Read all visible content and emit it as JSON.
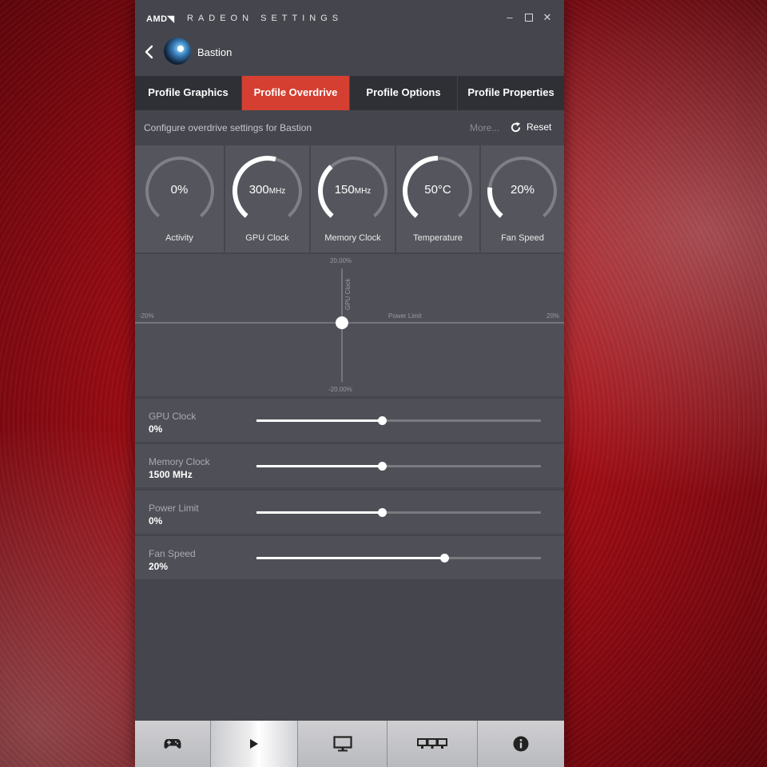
{
  "window": {
    "brand": "AMD◥",
    "title": "RADEON SETTINGS"
  },
  "profile": {
    "name": "Bastion"
  },
  "tabs": [
    {
      "label": "Profile Graphics",
      "active": false
    },
    {
      "label": "Profile Overdrive",
      "active": true
    },
    {
      "label": "Profile Options",
      "active": false
    },
    {
      "label": "Profile Properties",
      "active": false
    }
  ],
  "config": {
    "description": "Configure overdrive settings for Bastion",
    "more_label": "More...",
    "reset_label": "Reset"
  },
  "gauges": [
    {
      "value": "0%",
      "unit": "",
      "label": "Activity",
      "level": 0.0
    },
    {
      "value": "300",
      "unit": "MHz",
      "label": "GPU Clock",
      "level": 0.55
    },
    {
      "value": "150",
      "unit": "MHz",
      "label": "Memory Clock",
      "level": 0.35
    },
    {
      "value": "50°C",
      "unit": "",
      "label": "Temperature",
      "level": 0.5
    },
    {
      "value": "20%",
      "unit": "",
      "label": "Fan Speed",
      "level": 0.2
    }
  ],
  "graph": {
    "y_max_label": "20.00%",
    "y_min_label": "-20.00%",
    "x_min_label": "-20%",
    "x_max_label": "20%",
    "x_axis_label": "Power Limit",
    "y_axis_label": "GPU Clock",
    "point": {
      "x": 0,
      "y": 0
    }
  },
  "sliders": [
    {
      "label": "GPU Clock",
      "value": "0%",
      "level": 0.44
    },
    {
      "label": "Memory Clock",
      "value": "1500 MHz",
      "level": 0.44
    },
    {
      "label": "Power Limit",
      "value": "0%",
      "level": 0.44
    },
    {
      "label": "Fan Speed",
      "value": "20%",
      "level": 0.66
    }
  ],
  "bottom_nav": [
    {
      "icon": "gamepad-icon",
      "active": false
    },
    {
      "icon": "play-icon",
      "active": true
    },
    {
      "icon": "display-icon",
      "active": false
    },
    {
      "icon": "eyefinity-icon",
      "active": false
    },
    {
      "icon": "info-icon",
      "active": false
    }
  ]
}
